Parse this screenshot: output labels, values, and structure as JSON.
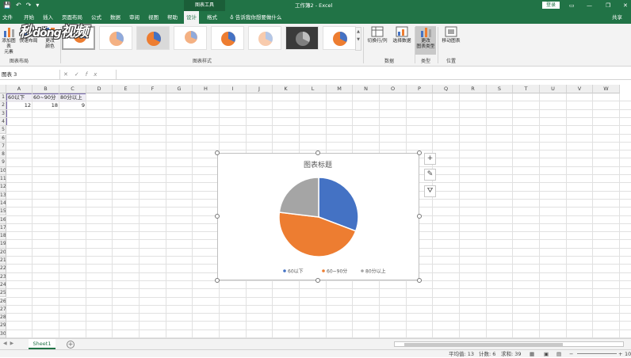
{
  "window": {
    "title": "工作簿2 - Excel",
    "context_tab_group": "图表工具",
    "login_label": "登录",
    "minimize": "—",
    "restore": "❐",
    "close": "✕"
  },
  "ribbon_tabs": [
    {
      "label": "文件"
    },
    {
      "label": "开始"
    },
    {
      "label": "插入"
    },
    {
      "label": "页面布局"
    },
    {
      "label": "公式"
    },
    {
      "label": "数据"
    },
    {
      "label": "审阅"
    },
    {
      "label": "视图"
    },
    {
      "label": "帮助"
    },
    {
      "label": "设计"
    },
    {
      "label": "格式"
    }
  ],
  "tell_me": "告诉我你想要做什么",
  "share": "共享",
  "ribbon": {
    "add_chart_element": "添加图表\n元素",
    "quick_layout": "快速布局",
    "change_colors": "更改\n颜色",
    "group_chart_layout": "图表布局",
    "group_chart_styles": "图表样式",
    "switch_row_col": "切换行/列",
    "select_data": "选择数据",
    "group_data": "数据",
    "change_chart_type": "更改\n图表类型",
    "group_type": "类型",
    "move_chart": "移动图表",
    "group_location": "位置"
  },
  "formula_bar": {
    "name_box": "图表 3",
    "fx": "fx",
    "value": ""
  },
  "columns": [
    "A",
    "B",
    "C",
    "D",
    "E",
    "F",
    "G",
    "H",
    "I",
    "J",
    "K",
    "L",
    "M",
    "N",
    "O",
    "P",
    "Q",
    "R",
    "S",
    "T",
    "U",
    "V",
    "W"
  ],
  "rows": [
    "1",
    "2",
    "3",
    "4",
    "5",
    "6",
    "7",
    "8",
    "9",
    "10",
    "11",
    "12",
    "13",
    "14",
    "15",
    "16",
    "17",
    "18",
    "19",
    "20",
    "21",
    "22",
    "23",
    "24",
    "25",
    "26",
    "27",
    "28",
    "29",
    "30"
  ],
  "cells": {
    "A1": "60以下",
    "B1": "60~90分",
    "C1": "80分以上",
    "A2": "12",
    "B2": "18",
    "C2": "9"
  },
  "chart_data": {
    "type": "pie",
    "title": "图表标题",
    "categories": [
      "60以下",
      "60~90分",
      "80分以上"
    ],
    "values": [
      12,
      18,
      9
    ],
    "colors": [
      "#4472c4",
      "#ed7d31",
      "#a5a5a5"
    ],
    "legend_position": "bottom"
  },
  "sheets": [
    {
      "name": "Sheet1"
    }
  ],
  "status": {
    "average": "平均值: 13",
    "count": "计数: 6",
    "sum": "求和: 39",
    "zoom": "100%"
  },
  "watermark": "秒懂视频"
}
